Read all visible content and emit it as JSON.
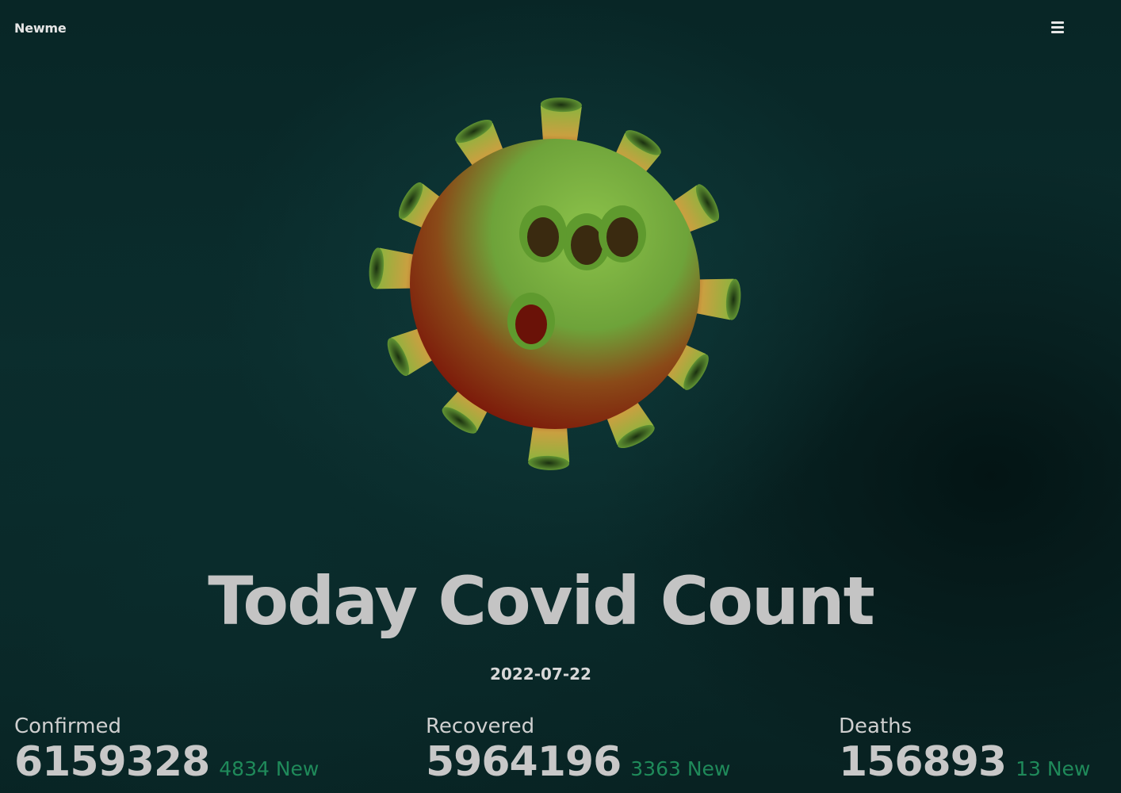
{
  "header": {
    "brand": "Newme",
    "menu_icon": "hamburger-menu-icon"
  },
  "hero": {
    "image": "coronavirus-illustration",
    "title": "Today Covid Count",
    "date": "2022-07-22"
  },
  "stats": [
    {
      "label": "Confirmed",
      "value": "6159328",
      "new": "4834 New"
    },
    {
      "label": "Recovered",
      "value": "5964196",
      "new": "3363 New"
    },
    {
      "label": "Deaths",
      "value": "156893",
      "new": "13 New"
    }
  ],
  "colors": {
    "background": "#0b2d2d",
    "title": "#c4c4c4",
    "new_accent": "#1f8a5a",
    "virus_green": "#7fb040",
    "virus_red": "#8a1a10"
  }
}
